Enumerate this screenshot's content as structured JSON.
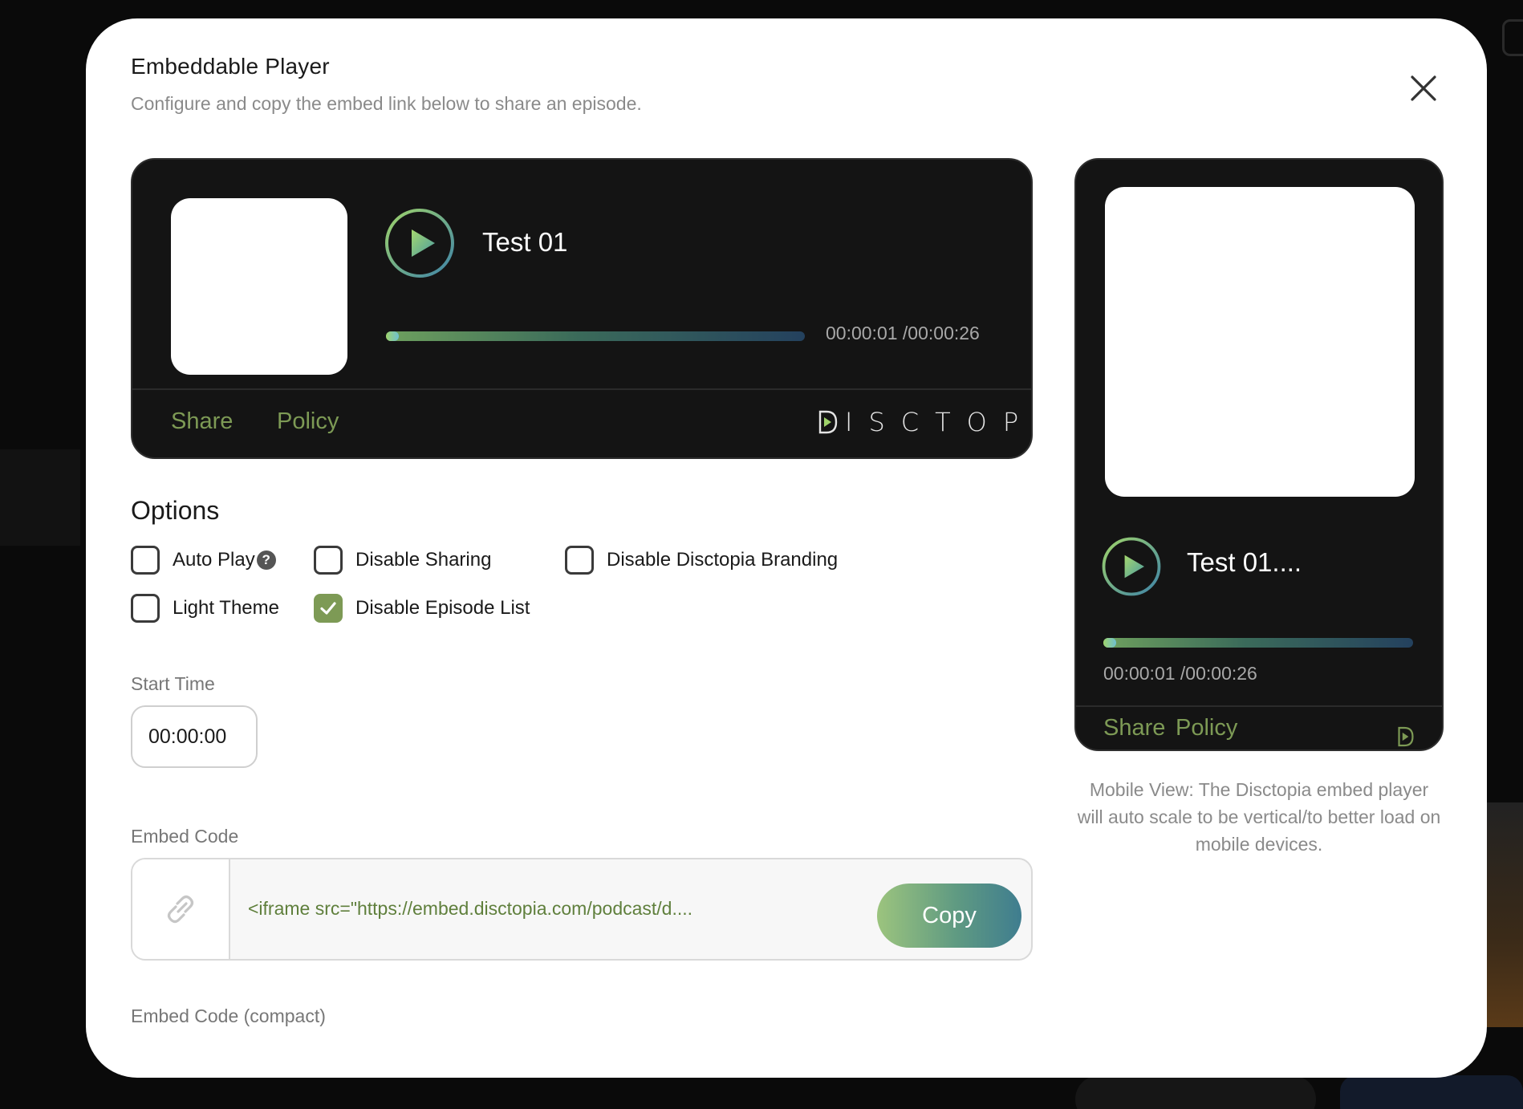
{
  "modal": {
    "title": "Embeddable Player",
    "subtitle": "Configure and copy the embed link below to share an episode."
  },
  "player": {
    "episode_title": "Test 01",
    "current_time": "00:00:01",
    "total_time": "/00:00:26",
    "progress_fraction": 0.04,
    "share_label": "Share",
    "policy_label": "Policy",
    "brand_name": "ISCTOPIA",
    "brand_icon": "disctopia-play-d-icon"
  },
  "mobile_player": {
    "episode_title": "Test 01....",
    "time_text": "00:00:01 /00:00:26",
    "share_label": "Share",
    "policy_label": "Policy",
    "note": "Mobile View: The Disctopia embed player will auto scale to be vertical/to better load on mobile devices."
  },
  "options": {
    "title": "Options",
    "items": [
      {
        "label": "Auto Play",
        "checked": false,
        "help": "?"
      },
      {
        "label": "Disable Sharing",
        "checked": false
      },
      {
        "label": "Disable Disctopia Branding",
        "checked": false
      },
      {
        "label": "Light Theme",
        "checked": false
      },
      {
        "label": "Disable Episode List",
        "checked": true
      }
    ]
  },
  "start_time": {
    "label": "Start Time",
    "value": "00:00:00"
  },
  "embed": {
    "label": "Embed Code",
    "code": "<iframe src=\"https://embed.disctopia.com/podcast/d....",
    "copy_label": "Copy",
    "compact_label": "Embed Code (compact)"
  },
  "colors": {
    "accent_green": "#7d9a55",
    "player_bg": "#141414",
    "modal_bg": "#ffffff"
  },
  "icons": {
    "close": "close-icon",
    "link": "link-icon",
    "play": "play-icon",
    "check": "check-icon",
    "help": "help-icon"
  }
}
